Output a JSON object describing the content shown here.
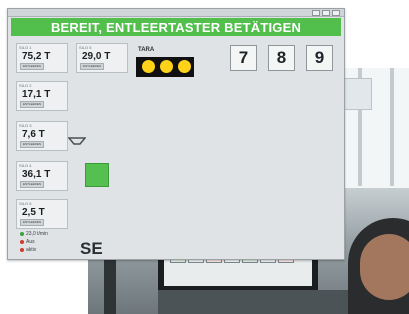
{
  "hmi": {
    "banner": "BEREIT, ENTLEERTASTER BETÄTIGEN",
    "tiles": [
      {
        "id": "SILO 1",
        "value": "75,2 T",
        "tag": "ENTLEEREN"
      },
      {
        "id": "SILO 5",
        "value": "29,0 T",
        "tag": "ENTLEEREN"
      },
      {
        "id": "SILO 2",
        "value": "17,1 T",
        "tag": "ENTLEEREN"
      },
      {
        "id": "SILO 3",
        "value": "7,6 T",
        "tag": "ENTLEEREN"
      },
      {
        "id": "SILO 4",
        "value": "36,1 T",
        "tag": "ENTLEEREN"
      },
      {
        "id": "SILO 6",
        "value": "2,5 T",
        "tag": "ENTLEEREN"
      }
    ],
    "tara_label": "TARA",
    "numpad": [
      "7",
      "8",
      "9"
    ],
    "se_text": "SE",
    "legend": [
      {
        "text": "23,0 t/min",
        "color": "#3aa23a"
      },
      {
        "text": "Aus",
        "color": "#d43a2a"
      },
      {
        "text": "aktiv",
        "color": "#d43a2a"
      }
    ],
    "colors": {
      "banner": "#52bf4d",
      "lamp": "#ffd21a"
    }
  },
  "photo": {
    "icons": [
      "monitor-icon",
      "operator-icon"
    ]
  }
}
